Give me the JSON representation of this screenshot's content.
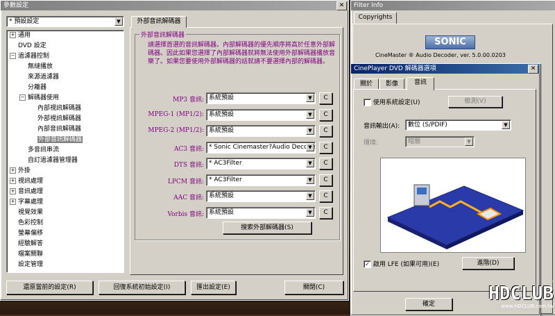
{
  "main_window": {
    "title": "參數設定",
    "preset_value": "* 預設設定",
    "tree": [
      {
        "label": "通用",
        "level": 0,
        "pm": "+"
      },
      {
        "label": "DVD 設定",
        "level": 0,
        "pm": ""
      },
      {
        "label": "過濾器控制",
        "level": 0,
        "pm": "−"
      },
      {
        "label": "無縫播放",
        "level": 1,
        "pm": ""
      },
      {
        "label": "來源過濾器",
        "level": 1,
        "pm": ""
      },
      {
        "label": "分離器",
        "level": 1,
        "pm": ""
      },
      {
        "label": "解碼器使用",
        "level": 1,
        "pm": "−"
      },
      {
        "label": "內部視訊解碼器",
        "level": 2,
        "pm": ""
      },
      {
        "label": "外部視訊解碼器",
        "level": 2,
        "pm": ""
      },
      {
        "label": "內部音訊解碼器",
        "level": 2,
        "pm": ""
      },
      {
        "label": "外部音訊解碼器",
        "level": 2,
        "pm": "",
        "selected": true
      },
      {
        "label": "多音訊串流",
        "level": 1,
        "pm": ""
      },
      {
        "label": "自訂過濾器管理器",
        "level": 1,
        "pm": ""
      },
      {
        "label": "外掛",
        "level": 0,
        "pm": "+"
      },
      {
        "label": "視訊處理",
        "level": 0,
        "pm": "+"
      },
      {
        "label": "音訊處理",
        "level": 0,
        "pm": "+"
      },
      {
        "label": "字幕處理",
        "level": 0,
        "pm": "+"
      },
      {
        "label": "視覺效果",
        "level": 0,
        "pm": ""
      },
      {
        "label": "色彩控制",
        "level": 0,
        "pm": ""
      },
      {
        "label": "螢幕偏移",
        "level": 0,
        "pm": ""
      },
      {
        "label": "經驗解答",
        "level": 0,
        "pm": ""
      },
      {
        "label": "檔案關聯",
        "level": 0,
        "pm": ""
      },
      {
        "label": "設定管理",
        "level": 0,
        "pm": ""
      }
    ],
    "tab_label": "外部音訊解碼器",
    "group_title": "外部音訊解碼器",
    "description": "請選擇首選的音訊解碼器。內部解碼器的優先順序將高於任意外部解碼器。因此如果您選擇了內部解碼器就將無法使用外部解碼器播放音樂了。如果您要使用外部解碼器的話就請不要選擇內部的解碼器。",
    "rows": [
      {
        "label": "MP3 音訊:",
        "value": "系統預設"
      },
      {
        "label": "MPEG-1 (MP1/2):",
        "value": "系統預設"
      },
      {
        "label": "MPEG-2 (MP1/2):",
        "value": "系統預設"
      },
      {
        "label": "AC3 音訊:",
        "value": "* Sonic Cinemaster?Audio Decoder 4"
      },
      {
        "label": "DTS 音訊:",
        "value": "* AC3Filter"
      },
      {
        "label": "LPCM 音訊:",
        "value": "* AC3Filter"
      },
      {
        "label": "AAC 音訊:",
        "value": "系統預設"
      },
      {
        "label": "Vorbis 音訊:",
        "value": "系統預設"
      }
    ],
    "c_button": "C",
    "search_button": "搜索外部解碼器(S)",
    "bottom_buttons": [
      "還原當前的設定(R)",
      "回復系統初始設定(I)",
      "匯出設定(E)",
      "關閉(C)"
    ]
  },
  "filter_window": {
    "title": "Filter Info",
    "tab": "Copyrights",
    "logo": "SONIC",
    "version_text": "CineMaster ® Audio Decoder, ver.  5.0.00.0203"
  },
  "cine_dialog": {
    "title": "CinePlayer DVD 解碼器選項",
    "tabs": [
      "關於",
      "影像",
      "音訊"
    ],
    "use_system": "使用系統設定(U)",
    "detect_button": "檢測(V)",
    "output_label": "音訊輸出(A):",
    "output_value": "數位 (S/PDIF)",
    "env_label": "環境:",
    "env_value": "暗闇",
    "lfe_label": "啟用 LFE (如果可用)(E)",
    "advanced_button": "進階(D)",
    "ok_button": "確定"
  },
  "watermark": {
    "small": "High Definition Vision Club",
    "big": "HDCLUB",
    "url": "www.HDCLUB.com.tw"
  }
}
